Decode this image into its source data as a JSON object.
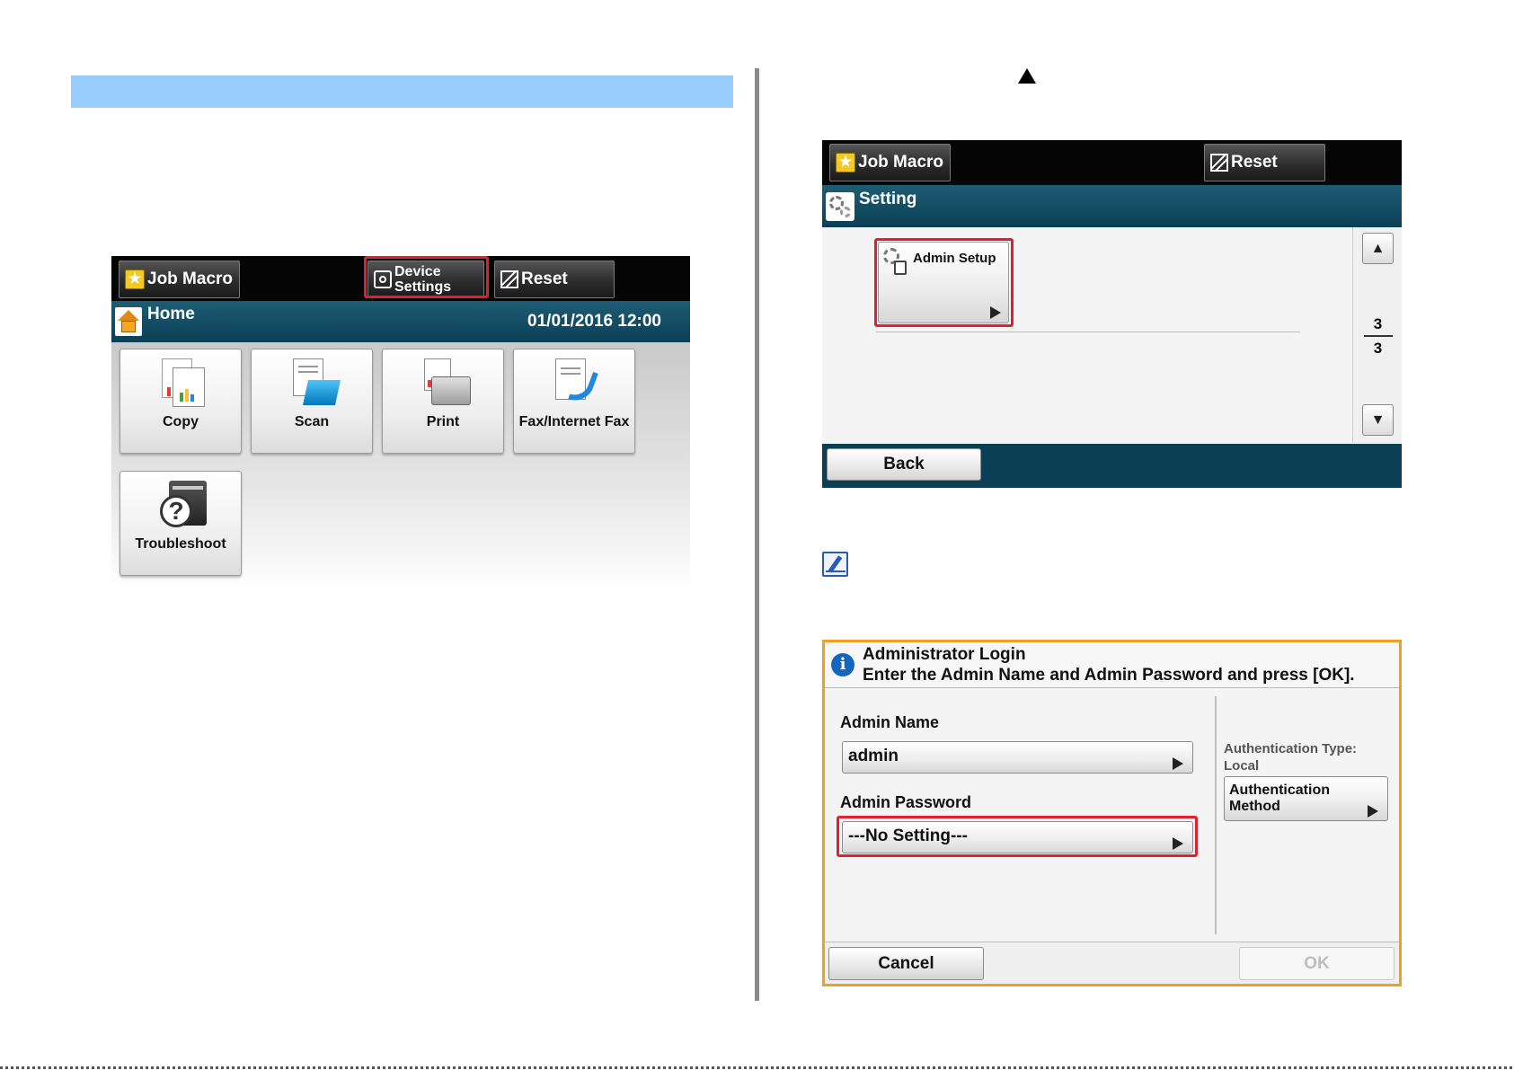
{
  "left_section": {
    "home_screen": {
      "top_bar": {
        "job_macro_label": "Job Macro",
        "device_settings_line1": "Device",
        "device_settings_line2": "Settings",
        "reset_label": "Reset"
      },
      "title": "Home",
      "datetime": "01/01/2016 12:00",
      "tiles": [
        {
          "label": "Copy",
          "icon": "copy-icon"
        },
        {
          "label": "Scan",
          "icon": "scan-icon"
        },
        {
          "label": "Print",
          "icon": "print-icon"
        },
        {
          "label": "Fax/Internet Fax",
          "icon": "fax-icon"
        },
        {
          "label": "Troubleshoot",
          "icon": "troubleshoot-icon"
        }
      ]
    }
  },
  "right_section": {
    "step_icon": "up-triangle-icon",
    "setting_screen": {
      "top_bar": {
        "job_macro_label": "Job Macro",
        "reset_label": "Reset"
      },
      "title": "Setting",
      "items": [
        {
          "label": "Admin Setup",
          "icon": "admin-setup-icon"
        }
      ],
      "page_current": "3",
      "page_total": "3",
      "back_label": "Back"
    },
    "note_icon": "memo-pencil-icon",
    "login_dialog": {
      "title": "Administrator Login",
      "message": "Enter the Admin Name and Admin Password and press [OK].",
      "admin_name_label": "Admin Name",
      "admin_name_value": "admin",
      "admin_password_label": "Admin Password",
      "admin_password_value": "---No Setting---",
      "auth_type_label": "Authentication Type:",
      "auth_type_value": "Local",
      "auth_method_line1": "Authentication",
      "auth_method_line2": "Method",
      "cancel_label": "Cancel",
      "ok_label": "OK"
    }
  },
  "colors": {
    "highlight_red": "#e02030",
    "title_bar_teal": "#0b3f55",
    "header_band_blue": "#99ccff",
    "dialog_border_orange": "#f0a020"
  }
}
